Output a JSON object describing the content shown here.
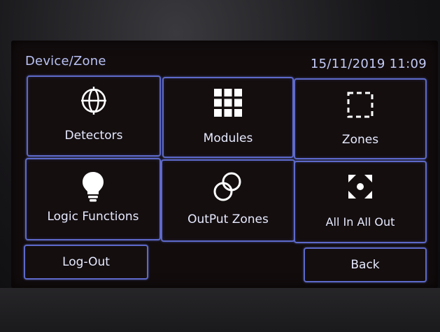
{
  "header": {
    "title": "Device/Zone",
    "datetime": "15/11/2019 11:09"
  },
  "tiles": [
    {
      "label": "Detectors",
      "icon": "globe-crosshair-icon"
    },
    {
      "label": "Modules",
      "icon": "grid-icon"
    },
    {
      "label": "Zones",
      "icon": "dashed-square-icon"
    },
    {
      "label": "Logic Functions",
      "icon": "lightbulb-icon"
    },
    {
      "label": "OutPut Zones",
      "icon": "overlapping-circles-icon"
    },
    {
      "label": "All In All Out",
      "icon": "corner-arrows-dot-icon"
    }
  ],
  "footer": {
    "logout_label": "Log-Out",
    "back_label": "Back"
  },
  "colors": {
    "accent_border": "#5d69c9",
    "text": "#e7eaff",
    "header_text": "#b9c2f4",
    "screen_bg": "#120c0d"
  }
}
